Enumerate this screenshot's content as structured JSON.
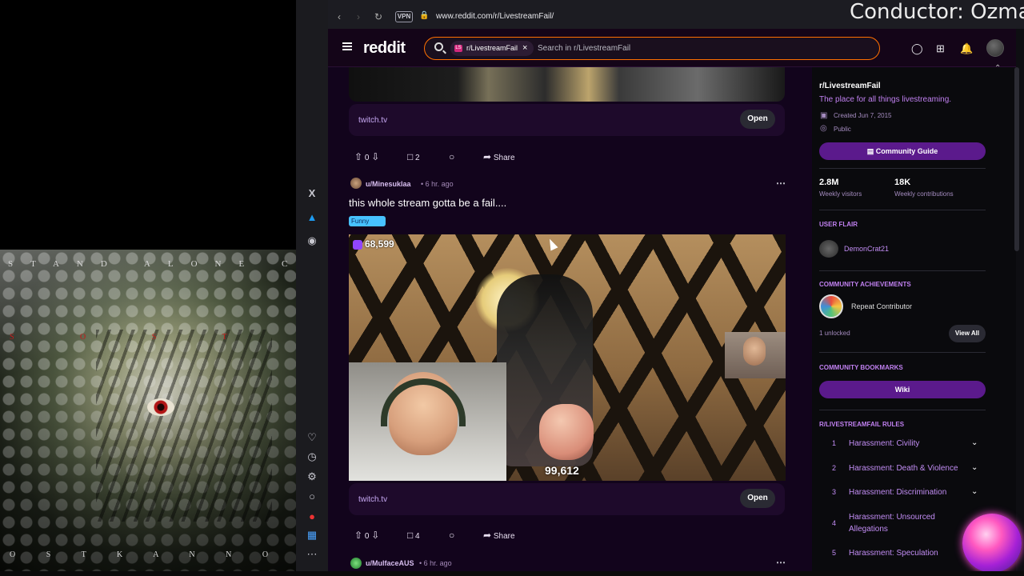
{
  "overlay": {
    "conductor": "Conductor: Ozma"
  },
  "album": {
    "top_text": "STAND ALONE COMPLE",
    "mid_text": "S O   S T",
    "bottom_text": "O S T   K A N N O   Y O"
  },
  "browser": {
    "url": "www.reddit.com/r/LivestreamFail/",
    "vpn": "VPN"
  },
  "reddit": {
    "logo": "reddit",
    "search_chip": "r/LivestreamFail",
    "search_placeholder": "Search in r/LivestreamFail"
  },
  "feed": {
    "post1": {
      "link": "twitch.tv",
      "open": "Open",
      "votes": "0",
      "comments": "2",
      "share": "Share"
    },
    "post2": {
      "user": "u/Minesuklaa",
      "time": "6 hr. ago",
      "title": "this whole stream gotta be a fail....",
      "flair": "Funny",
      "viewers": "68,599",
      "overlay_count": "99,612",
      "link": "twitch.tv",
      "open": "Open",
      "votes": "0",
      "comments": "4",
      "share": "Share"
    },
    "post3": {
      "user": "u/MulfaceAUS",
      "time": "6 hr. ago"
    }
  },
  "sidebar": {
    "title": "r/LivestreamFail",
    "description": "The place for all things livestreaming.",
    "created": "Created Jun 7, 2015",
    "visibility": "Public",
    "guide": "Community Guide",
    "visitors_value": "2.8M",
    "visitors_label": "Weekly visitors",
    "contrib_value": "18K",
    "contrib_label": "Weekly contributions",
    "user_flair_head": "USER FLAIR",
    "user_flair_name": "DemonCrat21",
    "achievements_head": "COMMUNITY ACHIEVEMENTS",
    "achievement": "Repeat Contributor",
    "unlocked": "1 unlocked",
    "view_all": "View All",
    "bookmarks_head": "COMMUNITY BOOKMARKS",
    "wiki": "Wiki",
    "rules_head": "R/LIVESTREAMFAIL RULES",
    "rules": [
      {
        "num": "1",
        "text": "Harassment: Civility"
      },
      {
        "num": "2",
        "text": "Harassment: Death & Violence"
      },
      {
        "num": "3",
        "text": "Harassment: Discrimination"
      },
      {
        "num": "4",
        "text": "Harassment: Unsourced Allegations"
      },
      {
        "num": "5",
        "text": "Harassment: Speculation"
      }
    ]
  }
}
